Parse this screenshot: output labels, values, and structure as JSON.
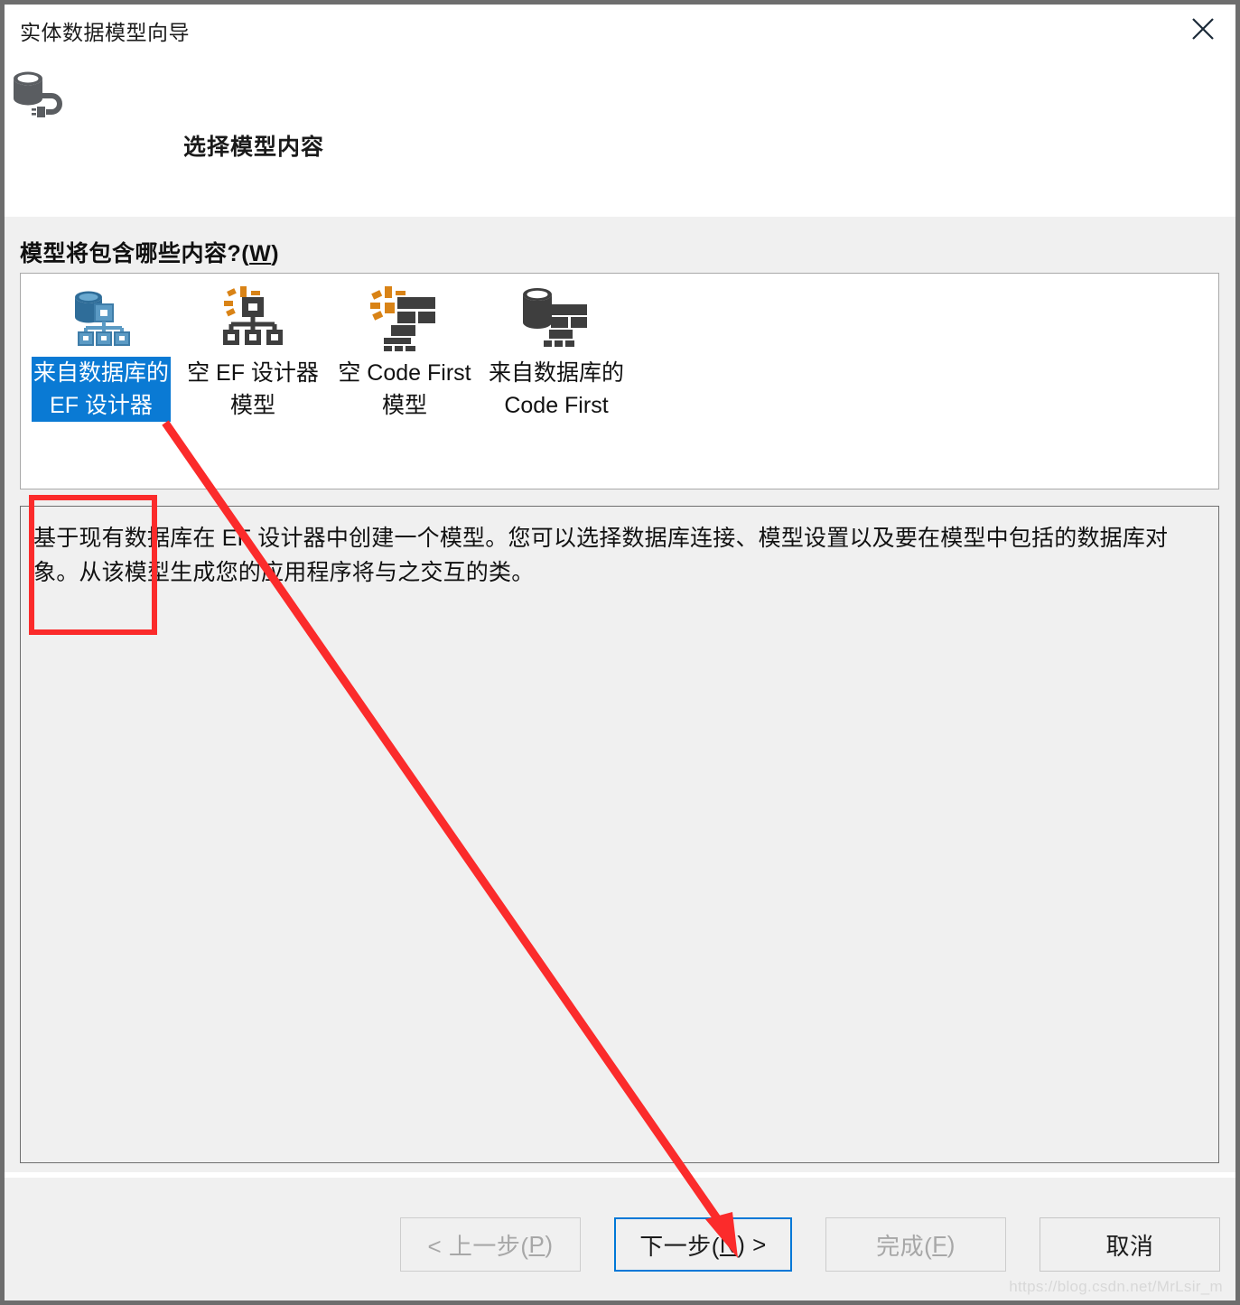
{
  "window": {
    "title": "实体数据模型向导",
    "close_label": "✕",
    "icon": "database-plug-icon"
  },
  "header": {
    "title": "选择模型内容",
    "icon": "database-wizard-icon"
  },
  "main": {
    "question_label_prefix": "模型将包含哪些内容?(",
    "question_label_accelerator": "W",
    "question_label_suffix": ")",
    "model_options": [
      {
        "label": "来自数据库的\nEF 设计器",
        "icon": "database-entity-model-icon",
        "selected": true,
        "annotated": true
      },
      {
        "label": "空 EF 设计器\n模型",
        "icon": "empty-entity-model-icon",
        "selected": false,
        "annotated": false
      },
      {
        "label": "空 Code First\n模型",
        "icon": "empty-code-first-icon",
        "selected": false,
        "annotated": false
      },
      {
        "label": "来自数据库的\nCode First",
        "icon": "database-code-first-icon",
        "selected": false,
        "annotated": false
      }
    ],
    "description": "基于现有数据库在 EF 设计器中创建一个模型。您可以选择数据库连接、模型设置以及要在模型中包括的数据库对象。从该模型生成您的应用程序将与之交互的类。"
  },
  "footer": {
    "back_button": "< 上一步(P)",
    "back_prefix": "< 上一步(",
    "back_accel": "P",
    "back_suffix": ")",
    "next_prefix": "下一步(",
    "next_accel": "N",
    "next_suffix": ") >",
    "finish_prefix": "完成(",
    "finish_accel": "F",
    "finish_suffix": ")",
    "cancel_label": "取消"
  },
  "annotations": {
    "watermark": "https://blog.csdn.net/MrLsir_m",
    "highlight_color": "#fb2b2b",
    "selection_color": "#0a7ad4",
    "focus_color": "#0078d7"
  }
}
